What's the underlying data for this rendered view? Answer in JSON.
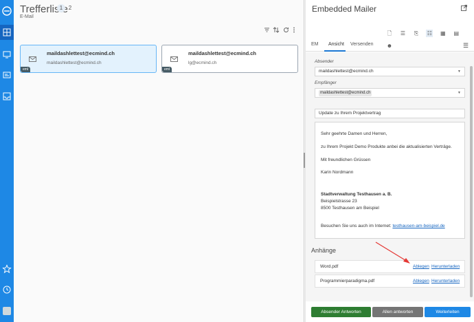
{
  "sidebar": {
    "icons": [
      "logo-icon",
      "grid-icon",
      "monitor-icon",
      "card-icon",
      "inbox-icon",
      "star-icon",
      "history-icon",
      "user-icon"
    ]
  },
  "resultlist": {
    "title": "Trefferliste",
    "pages": [
      "1",
      "2"
    ],
    "subtitle": "E-Mail",
    "cards": [
      {
        "from": "maildashlettest@ecmind.ch",
        "to": "maildashlettest@ecmind.ch",
        "badge": "eml",
        "selected": true
      },
      {
        "from": "maildashlettest@ecmind.ch",
        "to": "lg@ecmind.ch",
        "badge": "eml",
        "selected": false
      }
    ]
  },
  "mailer": {
    "title": "Embedded Mailer",
    "tabs": [
      "EM",
      "Ansicht",
      "Versenden"
    ],
    "sender_label": "Absender",
    "sender_value": "maildashlettest@ecmind.ch",
    "recipient_label": "Empfänger",
    "recipient_chip": "maildashlettest@ecmind.ch",
    "subject": "Update zu Ihrem Projektvertrag",
    "body": {
      "greeting": "Sehr geehrte Damen und Herren,",
      "line1": "zu Ihrem Projekt Demo Produkte anbei die aktualisierten Verträge.",
      "closing": "Mit freundlichen Grüssen",
      "name": "Karin Nordmann",
      "org": "Stadtverwaltung Testhausen a. B.",
      "street": "Beispielstrasse 23",
      "city": "8500 Testhausen am Beispiel",
      "web_prefix": "Besuchen Sie uns auch im Internet: ",
      "web_link": "testhausen-am-beispiel.de"
    },
    "attachments_title": "Anhänge",
    "attachments": [
      {
        "name": "Word.pdf",
        "file": "Ablegen",
        "download": "Herunterladen"
      },
      {
        "name": "Programmierparadigma.pdf",
        "file": "Ablegen",
        "download": "Herunterladen"
      }
    ],
    "buttons": {
      "reply_sender": "Absender Antworten",
      "reply_all": "Allen antworten",
      "forward": "Weiterleiten"
    }
  }
}
